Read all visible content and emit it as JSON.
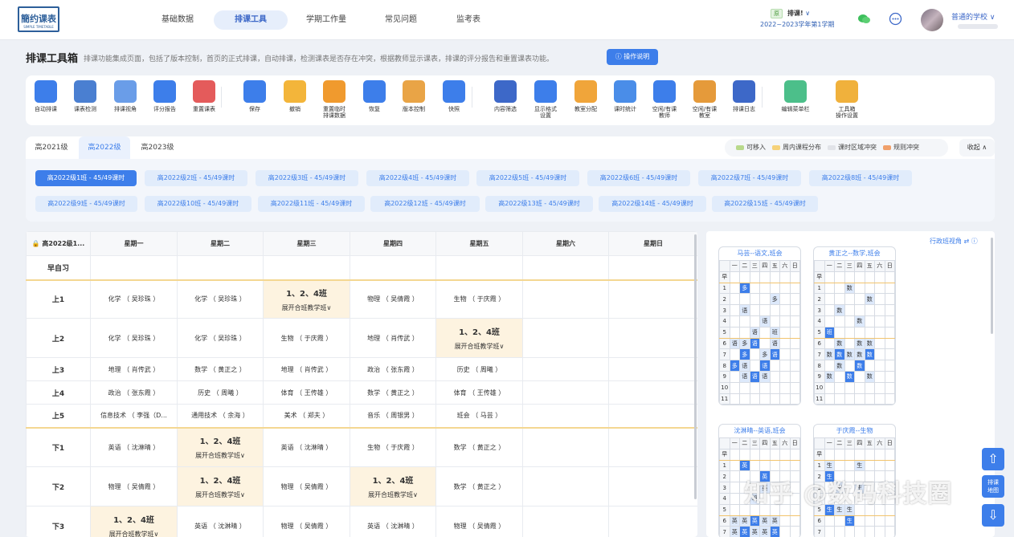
{
  "logo": {
    "name": "簡约课表",
    "sub": "SIMPLE TIMETABLE"
  },
  "nav": [
    "基础数据",
    "排课工具",
    "学期工作量",
    "常见问题",
    "监考表"
  ],
  "nav_active": 1,
  "semester": {
    "badge": "原",
    "label": "排课!",
    "chevron": "∨",
    "term": "2022~2023学年第1学期"
  },
  "user": {
    "school": "普通的学校",
    "chevron": "∨"
  },
  "page": {
    "title": "排课工具箱",
    "desc": "排课功能集成页面，包括了版本控制，首页的正式排课，自动排课，检测课表是否存在冲突，根据教师显示课表，排课的评分报告和重置课表功能。",
    "help": "操作说明"
  },
  "tools": [
    {
      "label": "自动排课",
      "icon": "auto-schedule-icon",
      "color": "#3d7eea"
    },
    {
      "label": "课表检测",
      "icon": "schedule-check-icon",
      "color": "#4a7fd1"
    },
    {
      "label": "排课视角",
      "icon": "schedule-view-icon",
      "color": "#6a9de8"
    },
    {
      "label": "评分报告",
      "icon": "score-report-icon",
      "color": "#3d7eea"
    },
    {
      "label": "重置课表",
      "icon": "reset-warning-icon",
      "color": "#e45b5b"
    },
    {
      "label": "保存",
      "icon": "save-icon",
      "color": "#3d7eea"
    },
    {
      "label": "撤销",
      "icon": "undo-icon",
      "color": "#f3b53a"
    },
    {
      "label": "重置临时\n排课数据",
      "icon": "reset-temp-icon",
      "color": "#f09a2e"
    },
    {
      "label": "恢复",
      "icon": "redo-icon",
      "color": "#3d7eea"
    },
    {
      "label": "版本控制",
      "icon": "version-icon",
      "color": "#e9a446"
    },
    {
      "label": "快照",
      "icon": "snapshot-icon",
      "color": "#3d7eea"
    },
    {
      "label": "内容筛选",
      "icon": "filter-icon",
      "color": "#3d68c8"
    },
    {
      "label": "显示格式\n设置",
      "icon": "gear-icon",
      "color": "#3d7eea"
    },
    {
      "label": "教室分配",
      "icon": "classroom-icon",
      "color": "#f0a53a"
    },
    {
      "label": "课时统计",
      "icon": "stats-cloud-icon",
      "color": "#4a8de8"
    },
    {
      "label": "空闲/有课\n教师",
      "icon": "teacher-free-icon",
      "color": "#3d7eea"
    },
    {
      "label": "空闲/有课\n教室",
      "icon": "room-free-icon",
      "color": "#e59a3a"
    },
    {
      "label": "排课日志",
      "icon": "log-icon",
      "color": "#3d68c8"
    },
    {
      "label": "编辑菜单栏",
      "icon": "edit-menu-icon",
      "color": "#4cbf8a"
    },
    {
      "label": "工具箱\n操作设置",
      "icon": "toolbox-settings-icon",
      "color": "#f0b13c"
    }
  ],
  "grades": [
    "高2021级",
    "高2022级",
    "高2023级"
  ],
  "grade_active": 1,
  "legend": [
    {
      "label": "可移入",
      "color": "#b8d98b"
    },
    {
      "label": "周内课程分布",
      "color": "#f6d27a"
    },
    {
      "label": "课时区域冲突",
      "color": "#e1e3e8"
    },
    {
      "label": "规则冲突",
      "color": "#f0a06b"
    }
  ],
  "collapse": "收起 ∧",
  "classes": [
    "高2022级1班 - 45/49课时",
    "高2022级2班 - 45/49课时",
    "高2022级3班 - 45/49课时",
    "高2022级4班 - 45/49课时",
    "高2022级5班 - 45/49课时",
    "高2022级6班 - 45/49课时",
    "高2022级7班 - 45/49课时",
    "高2022级8班 - 45/49课时",
    "高2022级9班 - 45/49课时",
    "高2022级10班 - 45/49课时",
    "高2022级11班 - 45/49课时",
    "高2022级12班 - 45/49课时",
    "高2022级13班 - 45/49课时",
    "高2022级14班 - 45/49课时",
    "高2022级15班 - 45/49课时"
  ],
  "schedule": {
    "corner": "高2022级1...",
    "days": [
      "星期一",
      "星期二",
      "星期三",
      "星期四",
      "星期五",
      "星期六",
      "星期日"
    ],
    "merge_title": "1、2、4班",
    "merge_sub": "展开合班教学班∨",
    "rows": [
      {
        "period": "早自习",
        "cells": [
          "",
          "",
          "",
          "",
          "",
          "",
          ""
        ]
      },
      {
        "period": "上1",
        "cells": [
          "化学 （ 吴珍珠 ）",
          "化学 （ 吴珍珠 ）",
          "@M",
          "物理 （ 吴倩霞 ）",
          "生物 （ 于庆霞 ）",
          "",
          ""
        ]
      },
      {
        "period": "上2",
        "cells": [
          "化学 （ 吴珍珠 ）",
          "化学 （ 吴珍珠 ）",
          "生物 （ 于庆霞 ）",
          "地理 （ 肖传武 ）",
          "@M",
          "",
          ""
        ]
      },
      {
        "period": "上3",
        "cells": [
          "地理 （ 肖传武 ）",
          "数学 （ 黄正之 ）",
          "地理 （ 肖传武 ）",
          "政治 （ 张东霞 ）",
          "历史 （ 周曦 ）",
          "",
          ""
        ]
      },
      {
        "period": "上4",
        "cells": [
          "政治 （ 张东霞 ）",
          "历史 （ 周曦 ）",
          "体育 （ 王传雄 ）",
          "数学 （ 黄正之 ）",
          "体育 （ 王传雄 ）",
          "",
          ""
        ]
      },
      {
        "period": "上5",
        "cells": [
          "信息技术 （ 李强（D...",
          "通用技术 （ 余海 ）",
          "美术 （ 郑夫 ）",
          "音乐 （ 周银男 ）",
          "班会 （ 马芸 ）",
          "",
          ""
        ]
      },
      {
        "period": "下1",
        "cells": [
          "英语 （ 沈淋晴 ）",
          "@M",
          "英语 （ 沈淋晴 ）",
          "生物 （ 于庆霞 ）",
          "数学 （ 黄正之 ）",
          "",
          ""
        ]
      },
      {
        "period": "下2",
        "cells": [
          "物理 （ 吴倩霞 ）",
          "@M",
          "物理 （ 吴倩霞 ）",
          "@M",
          "数学 （ 黄正之 ）",
          "",
          ""
        ]
      },
      {
        "period": "下3",
        "cells": [
          "@M",
          "英语 （ 沈淋晴 ）",
          "物理 （ 吴倩霞 ）",
          "英语 （ 沈淋晴 ）",
          "物理 （ 吴倩霞 ）",
          "",
          ""
        ]
      }
    ]
  },
  "right": {
    "view": "行政班视角 ⇄ ⓘ",
    "fab_top": "⇧",
    "fab_mid": "排课\n地图",
    "fab_bot": "⇩",
    "watermark": "知乎 @数码科技圈"
  },
  "minis": [
    {
      "title": "马芸--语文,班会",
      "rows": [
        [
          "早",
          "",
          "",
          "",
          "",
          "",
          "",
          ""
        ],
        [
          "1",
          "",
          "多",
          "",
          "",
          "",
          "",
          ""
        ],
        [
          "2",
          "",
          "",
          "",
          "",
          "多",
          "",
          ""
        ],
        [
          "3",
          "",
          "语",
          "",
          "",
          "",
          "",
          ""
        ],
        [
          "4",
          "",
          "",
          "",
          "语",
          "",
          "",
          ""
        ],
        [
          "5",
          "",
          "",
          "语",
          "",
          "班",
          "",
          ""
        ],
        [
          "6",
          "语",
          "多",
          "语",
          "",
          "语",
          "",
          ""
        ],
        [
          "7",
          "",
          "多",
          "",
          "多",
          "语",
          "",
          ""
        ],
        [
          "8",
          "多",
          "语",
          "",
          "语",
          "",
          "",
          ""
        ],
        [
          "9",
          "",
          "语",
          "语",
          "语",
          "",
          "",
          ""
        ],
        [
          "10",
          "",
          "",
          "",
          "",
          "",
          "",
          ""
        ],
        [
          "11",
          "",
          "",
          "",
          "",
          "",
          "",
          ""
        ]
      ]
    },
    {
      "title": "黄正之--数学,班会",
      "rows": [
        [
          "早",
          "",
          "",
          "",
          "",
          "",
          "",
          ""
        ],
        [
          "1",
          "",
          "",
          "数",
          "",
          "",
          "",
          ""
        ],
        [
          "2",
          "",
          "",
          "",
          "",
          "数",
          "",
          ""
        ],
        [
          "3",
          "",
          "数",
          "",
          "",
          "",
          "",
          ""
        ],
        [
          "4",
          "",
          "",
          "",
          "数",
          "",
          "",
          ""
        ],
        [
          "5",
          "班",
          "",
          "",
          "",
          "",
          "",
          ""
        ],
        [
          "6",
          "",
          "数",
          "",
          "数",
          "数",
          "",
          ""
        ],
        [
          "7",
          "数",
          "数",
          "数",
          "数",
          "数",
          "",
          ""
        ],
        [
          "8",
          "",
          "数",
          "",
          "数",
          "",
          "",
          ""
        ],
        [
          "9",
          "数",
          "",
          "数",
          "",
          "数",
          "",
          ""
        ],
        [
          "10",
          "",
          "",
          "",
          "",
          "",
          "",
          ""
        ],
        [
          "11",
          "",
          "",
          "",
          "",
          "",
          "",
          ""
        ]
      ]
    },
    {
      "title": "沈淋晴--英语,班会",
      "rows": [
        [
          "早",
          "",
          "",
          "",
          "",
          "",
          "",
          ""
        ],
        [
          "1",
          "",
          "英",
          "",
          "",
          "",
          "",
          ""
        ],
        [
          "2",
          "",
          "",
          "",
          "英",
          "",
          "",
          ""
        ],
        [
          "3",
          "",
          "",
          "",
          "英",
          "",
          "",
          ""
        ],
        [
          "4",
          "",
          "",
          "班",
          "",
          "",
          "",
          ""
        ],
        [
          "5",
          "",
          "",
          "",
          "",
          "",
          "",
          ""
        ],
        [
          "6",
          "英",
          "英",
          "英",
          "英",
          "英",
          "",
          ""
        ],
        [
          "7",
          "英",
          "英",
          "英",
          "英",
          "英",
          "",
          ""
        ]
      ]
    },
    {
      "title": "于庆霞--生物",
      "rows": [
        [
          "早",
          "",
          "",
          "",
          "",
          "",
          "",
          ""
        ],
        [
          "1",
          "生",
          "",
          "",
          "生",
          "",
          "",
          ""
        ],
        [
          "2",
          "生",
          "",
          "",
          "",
          "",
          "",
          ""
        ],
        [
          "3",
          "",
          "生",
          "",
          "生",
          "",
          "",
          ""
        ],
        [
          "4",
          "",
          "",
          "",
          "",
          "",
          "",
          ""
        ],
        [
          "5",
          "生",
          "生",
          "生",
          "",
          "",
          "",
          ""
        ],
        [
          "6",
          "",
          "",
          "生",
          "",
          "",
          "",
          ""
        ],
        [
          "7",
          "",
          "",
          "",
          "",
          "",
          "",
          ""
        ]
      ]
    }
  ],
  "mini_head": [
    "",
    "一",
    "二",
    "三",
    "四",
    "五",
    "六",
    "日"
  ]
}
